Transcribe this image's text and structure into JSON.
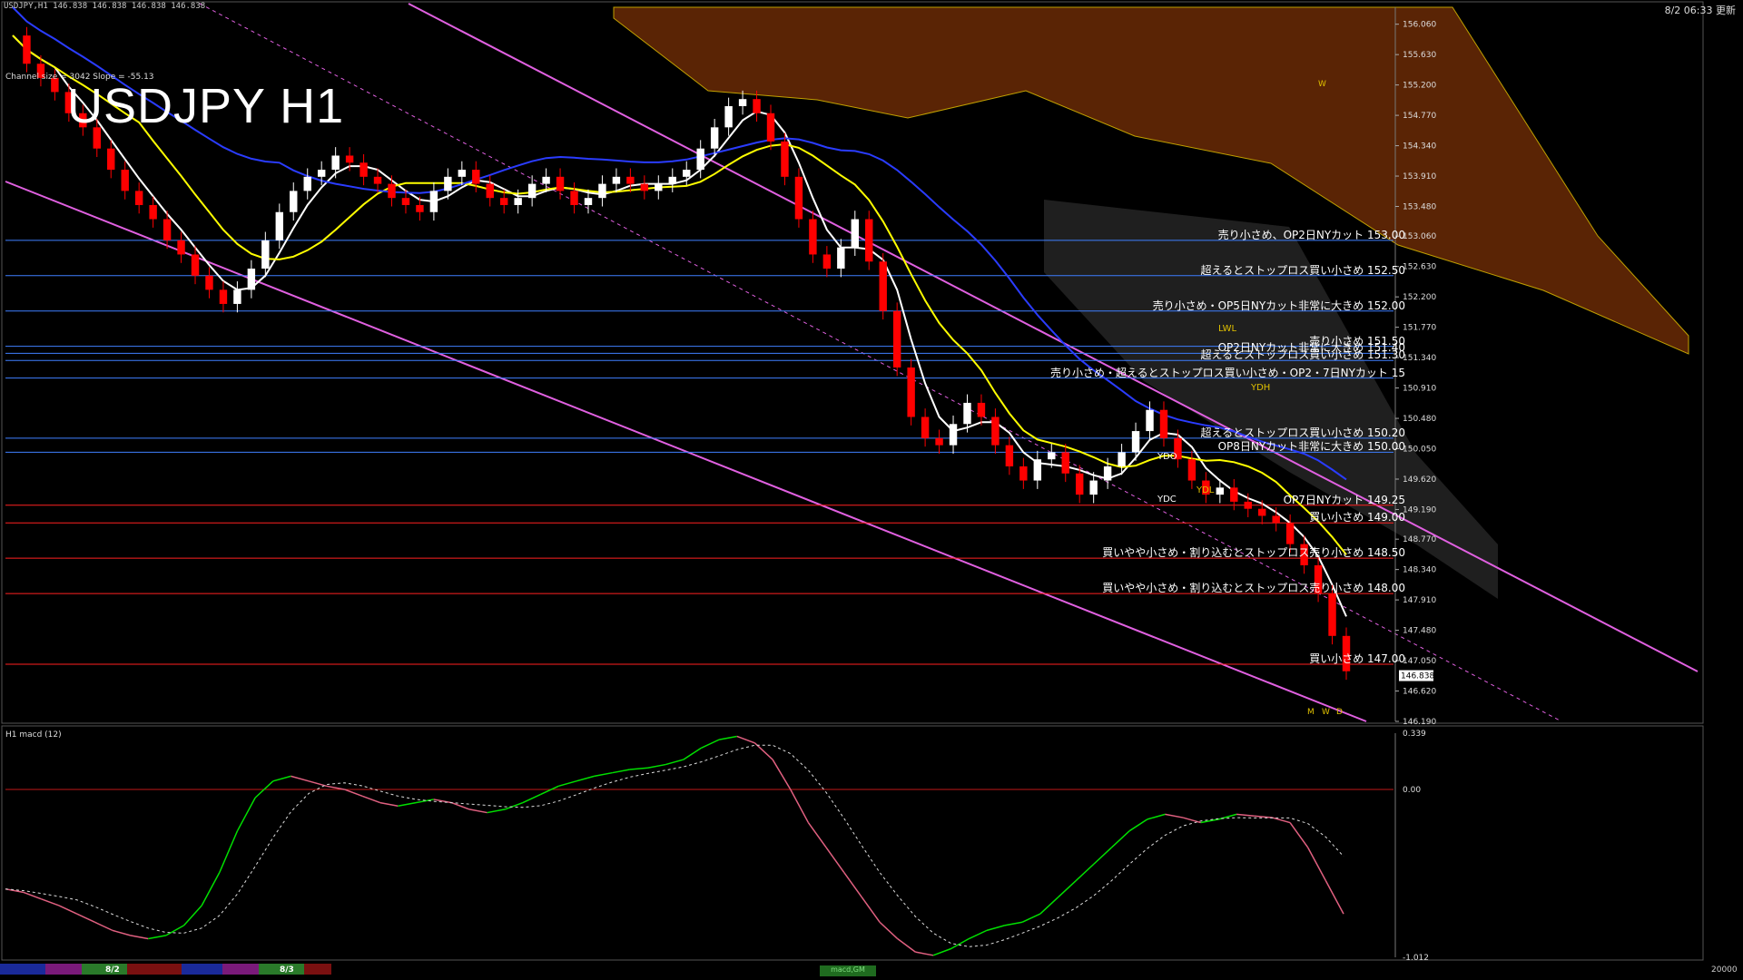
{
  "header": {
    "symbol_line": "USDJPY,H1  146.838 146.838 146.838 146.838",
    "timestamp": "8/2 06:33 更新",
    "channel_info": "Channel size = 3042 Slope = -55.13",
    "big_title": "USDJPY H1"
  },
  "macd_panel": {
    "label": "H1  macd (12)",
    "tab": "macd,GM",
    "ticks": [
      "0.339",
      "0.00",
      "-1.012"
    ],
    "zoom_value": "20000"
  },
  "time_axis": {
    "dates": [
      "8/2",
      "8/3"
    ]
  },
  "colors": {
    "background": "#000000",
    "bull_candle": "#ffffff",
    "bear_candle": "#ff0000",
    "ichimoku_cloud": "#c8500a",
    "ma_yellow": "#ffff00",
    "ma_blue": "#2a3cff",
    "ma_white": "#ffffff",
    "channel_line": "#e060e0",
    "level_line_blue": "#3f7fff",
    "level_line_red": "#ff2020",
    "macd_rising": "#00e000",
    "macd_falling": "#e06080"
  },
  "chart_data": {
    "type": "line",
    "symbol": "USDJPY",
    "timeframe": "H1",
    "y_axis": {
      "ticks": [
        156.06,
        155.63,
        155.2,
        154.77,
        154.34,
        153.91,
        153.48,
        153.06,
        152.63,
        152.2,
        151.77,
        151.34,
        150.91,
        150.48,
        150.05,
        149.62,
        149.19,
        148.77,
        148.34,
        147.91,
        147.48,
        147.05,
        146.62,
        146.19
      ],
      "ylim": [
        146.19,
        156.3
      ],
      "current_price": "146.838"
    },
    "price_series": [
      155.9,
      155.5,
      155.3,
      155.1,
      154.8,
      154.6,
      154.3,
      154.0,
      153.7,
      153.5,
      153.3,
      153.0,
      152.8,
      152.5,
      152.3,
      152.1,
      152.3,
      152.6,
      153.0,
      153.4,
      153.7,
      153.9,
      154.0,
      154.2,
      154.1,
      153.9,
      153.8,
      153.6,
      153.5,
      153.4,
      153.7,
      153.9,
      154.0,
      153.8,
      153.6,
      153.5,
      153.6,
      153.8,
      153.9,
      153.7,
      153.5,
      153.6,
      153.8,
      153.9,
      153.8,
      153.7,
      153.8,
      153.9,
      154.0,
      154.3,
      154.6,
      154.9,
      155.0,
      154.8,
      154.4,
      153.9,
      153.3,
      152.8,
      152.6,
      152.9,
      153.3,
      152.7,
      152.0,
      151.2,
      150.5,
      150.2,
      150.1,
      150.4,
      150.7,
      150.5,
      150.1,
      149.8,
      149.6,
      149.9,
      150.0,
      149.7,
      149.4,
      149.6,
      149.8,
      150.0,
      150.3,
      150.6,
      150.2,
      149.9,
      149.6,
      149.4,
      149.5,
      149.3,
      149.2,
      149.1,
      149.0,
      148.7,
      148.4,
      148.0,
      147.4,
      146.9
    ],
    "annotations": [
      {
        "text": "売り小さめ、OP2日NYカット 153.00",
        "price": 153.0
      },
      {
        "text": "超えるとストップロス買い小さめ 152.50",
        "price": 152.5
      },
      {
        "text": "売り小さめ・OP5日NYカット非常に大きめ 152.00",
        "price": 152.0
      },
      {
        "text": "売り小さめ 151.50",
        "price": 151.5
      },
      {
        "text": "OP2日NYカット非常に大きめ 151.40",
        "price": 151.4
      },
      {
        "text": "超えるとストップロス買い小さめ 151.30",
        "price": 151.3
      },
      {
        "text": "売り小さめ・超えるとストップロス買い小さめ・OP2・7日NYカット 15",
        "price": 151.05
      },
      {
        "text": "超えるとストップロス買い小さめ 150.20",
        "price": 150.2
      },
      {
        "text": "OP8日NYカット非常に大きめ 150.00",
        "price": 150.0
      },
      {
        "text": "OP7日NYカット 149.25",
        "price": 149.25
      },
      {
        "text": "買い小さめ 149.00",
        "price": 149.0
      },
      {
        "text": "買いやや小さめ・割り込むとストップロス売り小さめ 148.50",
        "price": 148.5
      },
      {
        "text": "買いやや小さめ・割り込むとストップロス売り小さめ 148.00",
        "price": 148.0
      },
      {
        "text": "買い小さめ 147.00",
        "price": 147.0
      }
    ],
    "box_labels": [
      "YDO",
      "YDC",
      "YDH",
      "YDL",
      "LWL"
    ],
    "period_marks": [
      "W",
      "M",
      "W",
      "D"
    ],
    "macd_series": [
      -0.6,
      -0.62,
      -0.66,
      -0.7,
      -0.75,
      -0.8,
      -0.85,
      -0.88,
      -0.9,
      -0.88,
      -0.82,
      -0.7,
      -0.5,
      -0.25,
      -0.05,
      0.05,
      0.08,
      0.05,
      0.02,
      0.0,
      -0.04,
      -0.08,
      -0.1,
      -0.08,
      -0.06,
      -0.08,
      -0.12,
      -0.14,
      -0.12,
      -0.08,
      -0.03,
      0.02,
      0.05,
      0.08,
      0.1,
      0.12,
      0.13,
      0.15,
      0.18,
      0.25,
      0.3,
      0.32,
      0.28,
      0.18,
      0.0,
      -0.2,
      -0.35,
      -0.5,
      -0.65,
      -0.8,
      -0.9,
      -0.98,
      -1.0,
      -0.96,
      -0.9,
      -0.85,
      -0.82,
      -0.8,
      -0.75,
      -0.65,
      -0.55,
      -0.45,
      -0.35,
      -0.25,
      -0.18,
      -0.15,
      -0.17,
      -0.2,
      -0.18,
      -0.15,
      -0.16,
      -0.17,
      -0.2,
      -0.35,
      -0.55,
      -0.75
    ],
    "macd_ylim": [
      -1.012,
      0.339
    ]
  }
}
